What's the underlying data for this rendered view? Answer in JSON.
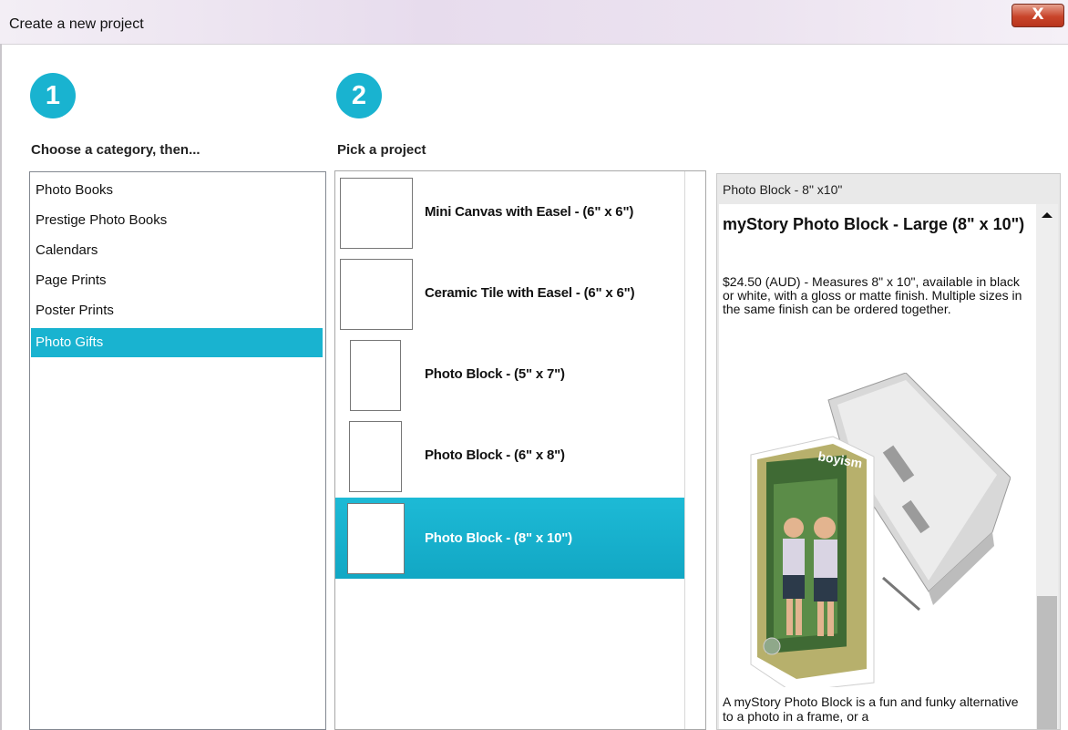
{
  "window": {
    "title": "Create a new project",
    "close_label": "X"
  },
  "steps": [
    {
      "number": "1",
      "label": "Choose a category, then..."
    },
    {
      "number": "2",
      "label": "Pick a project"
    }
  ],
  "categories": [
    {
      "label": "Photo Books",
      "selected": false
    },
    {
      "label": "Prestige Photo Books",
      "selected": false
    },
    {
      "label": "Calendars",
      "selected": false
    },
    {
      "label": "Page Prints",
      "selected": false
    },
    {
      "label": "Poster Prints",
      "selected": false
    },
    {
      "label": "Photo Gifts",
      "selected": true
    }
  ],
  "projects": [
    {
      "label": "Mini Canvas with Easel - (6\" x 6\")",
      "selected": false
    },
    {
      "label": "Ceramic Tile with Easel - (6\" x 6\")",
      "selected": false
    },
    {
      "label": "Photo Block - (5\" x 7\")",
      "selected": false
    },
    {
      "label": "Photo Block - (6\" x 8\")",
      "selected": false
    },
    {
      "label": "Photo Block - (8\" x 10\")",
      "selected": true
    }
  ],
  "detail": {
    "header": "Photo Block - 8\" x10\"",
    "title": "myStory Photo Block - Large (8\" x 10\")",
    "description": "$24.50 (AUD) - Measures 8\" x 10\", available in black or white, with a gloss or matte finish. Multiple sizes in the same finish can be ordered together.",
    "image_text": "boyism",
    "footer": "A myStory Photo Block is a fun and funky alternative to a photo in a frame, or a"
  },
  "colors": {
    "accent": "#19b3d0",
    "selected_text": "#ffffff"
  }
}
